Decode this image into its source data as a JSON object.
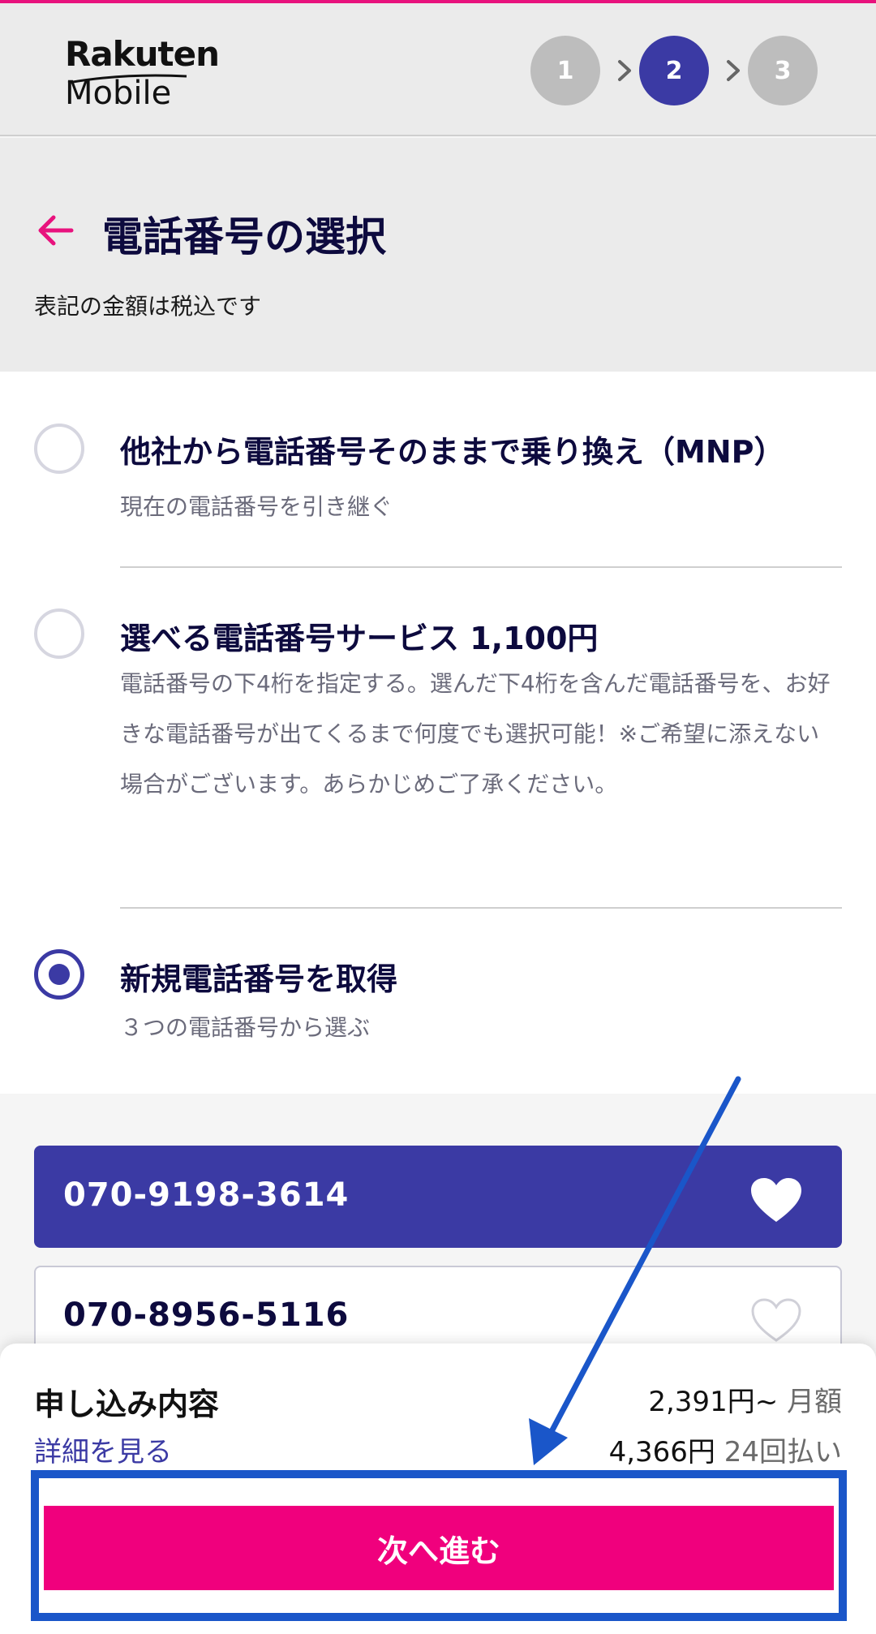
{
  "header": {
    "logo_line1": "Rakuten",
    "logo_line2": "Mobile",
    "steps": [
      {
        "label": "1",
        "state": "inactive"
      },
      {
        "label": "2",
        "state": "active"
      },
      {
        "label": "3",
        "state": "inactive"
      }
    ]
  },
  "titlebar": {
    "title": "電話番号の選択",
    "tax_note": "表記の金額は税込です"
  },
  "options": [
    {
      "title": "他社から電話番号そのままで乗り換え（MNP）",
      "description": "現在の電話番号を引き継ぐ",
      "selected": false
    },
    {
      "title": "選べる電話番号サービス 1,100円",
      "description": "電話番号の下4桁を指定する。選んだ下4桁を含んだ電話番号を、お好きな電話番号が出てくるまで何度でも選択可能！※ご希望に添えない場合がございます。あらかじめご了承ください。",
      "selected": false
    },
    {
      "title": "新規電話番号を取得",
      "description": "３つの電話番号から選ぶ",
      "selected": true
    }
  ],
  "numbers": [
    {
      "number": "070-9198-3614",
      "selected": true,
      "icon": "heart-filled-icon"
    },
    {
      "number": "070-8956-5116",
      "selected": false,
      "icon": "heart-outline-icon"
    }
  ],
  "summary": {
    "title": "申し込み内容",
    "detail_link": "詳細を見る",
    "price_monthly": "2,391円~",
    "price_monthly_unit": "月額",
    "price_installment": "4,366円",
    "price_installment_unit": "24回払い",
    "next_button": "次へ進む"
  },
  "colors": {
    "brand_pink": "#f0007d",
    "brand_purple": "#3b3aa4",
    "annotation_blue": "#1a56c9"
  }
}
